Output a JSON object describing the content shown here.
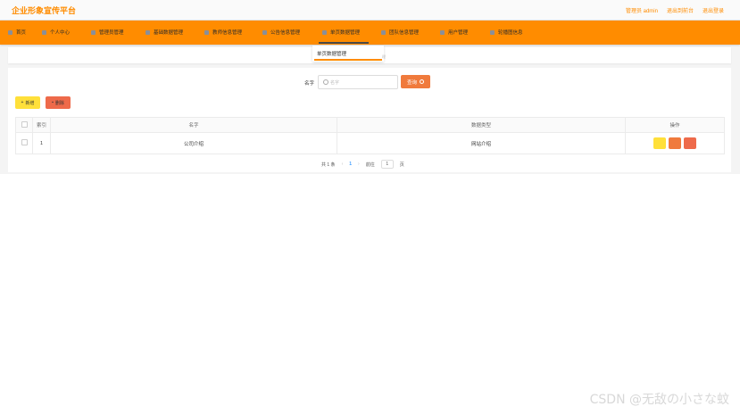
{
  "header": {
    "title": "企业形象宣传平台",
    "admin_label": "管理员 admin",
    "back_label": "退出到前台",
    "logout_label": "退出登录"
  },
  "nav": {
    "items": [
      {
        "label": "首页"
      },
      {
        "label": "个人中心"
      },
      {
        "label": "管理员管理"
      },
      {
        "label": "基础数据管理"
      },
      {
        "label": "教师信息管理"
      },
      {
        "label": "公告信息管理"
      },
      {
        "label": "单页数据管理"
      },
      {
        "label": "团队信息管理"
      },
      {
        "label": "用户管理"
      },
      {
        "label": "轮播图信息"
      }
    ],
    "dropdown_item": "单页数据管理",
    "dropdown_tail": "理"
  },
  "search": {
    "label": "名字",
    "placeholder": "名字",
    "button_label": "查询"
  },
  "actions": {
    "add_label": "新增",
    "delete_label": "删除"
  },
  "table": {
    "headers": [
      "索引",
      "名字",
      "数据类型",
      "操作"
    ],
    "rows": [
      {
        "index": "1",
        "name": "公司介绍",
        "type": "网站介绍"
      }
    ]
  },
  "pager": {
    "total": "共 1 条",
    "prev": "‹",
    "current": "1",
    "next": "›",
    "goto": "前往",
    "goto_value": "1",
    "page_unit": "页"
  },
  "watermark": "CSDN @无敌の小さな蚊",
  "colors": {
    "accent": "#ff8c00",
    "add": "#ffe03a",
    "search": "#f07a3c",
    "danger": "#ee6a4a"
  }
}
